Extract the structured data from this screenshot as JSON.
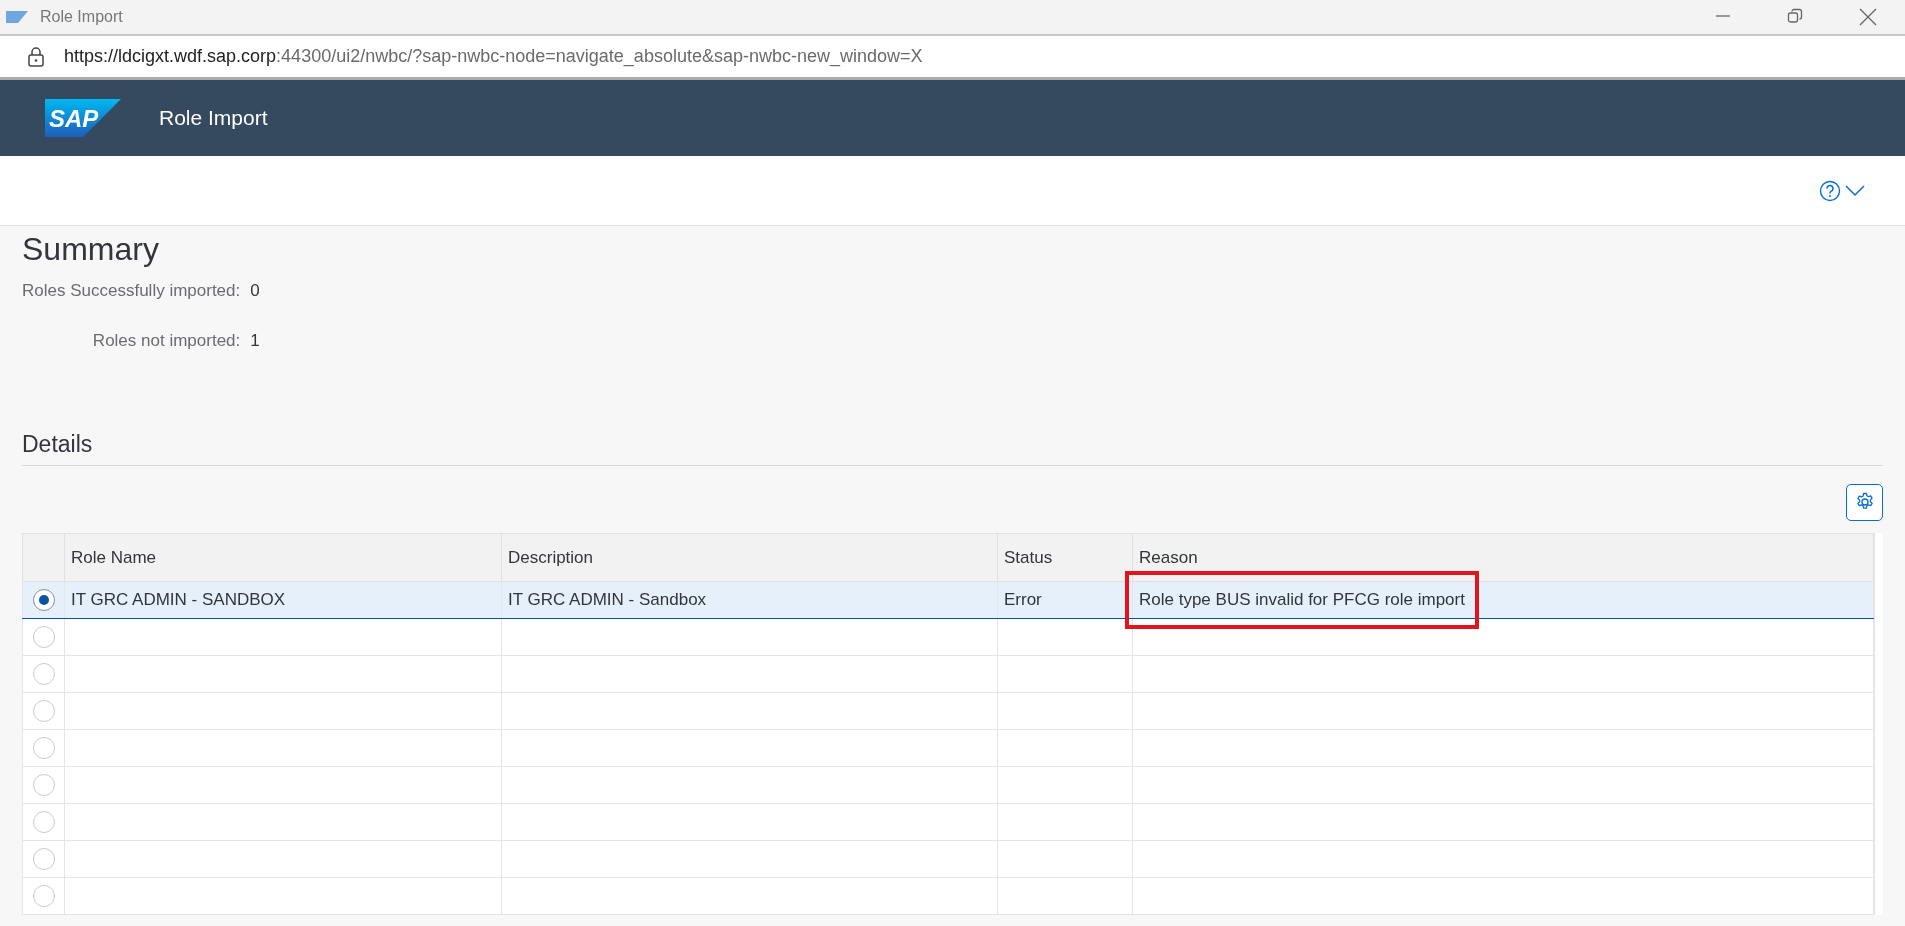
{
  "window": {
    "title": "Role Import"
  },
  "address_bar": {
    "url_host": "https://ldcigxt.wdf.sap.corp",
    "url_rest": ":44300/ui2/nwbc/?sap-nwbc-node=navigate_absolute&sap-nwbc-new_window=X"
  },
  "shell": {
    "logo": "SAP",
    "title": "Role Import"
  },
  "summary": {
    "heading": "Summary",
    "items": [
      {
        "label": "Roles Successfully imported:",
        "value": "0"
      },
      {
        "label": "Roles not imported:",
        "value": "1"
      }
    ]
  },
  "details": {
    "heading": "Details",
    "table": {
      "columns": [
        "Role Name",
        "Description",
        "Status",
        "Reason"
      ],
      "rows": [
        {
          "selected": true,
          "cells": [
            "IT GRC ADMIN - SANDBOX",
            "IT GRC ADMIN - Sandbox",
            "Error",
            "Role type BUS invalid for PFCG role import"
          ],
          "reason_highlighted": true
        },
        {
          "selected": false
        },
        {
          "selected": false
        },
        {
          "selected": false
        },
        {
          "selected": false
        },
        {
          "selected": false
        },
        {
          "selected": false
        },
        {
          "selected": false
        },
        {
          "selected": false
        }
      ]
    }
  }
}
